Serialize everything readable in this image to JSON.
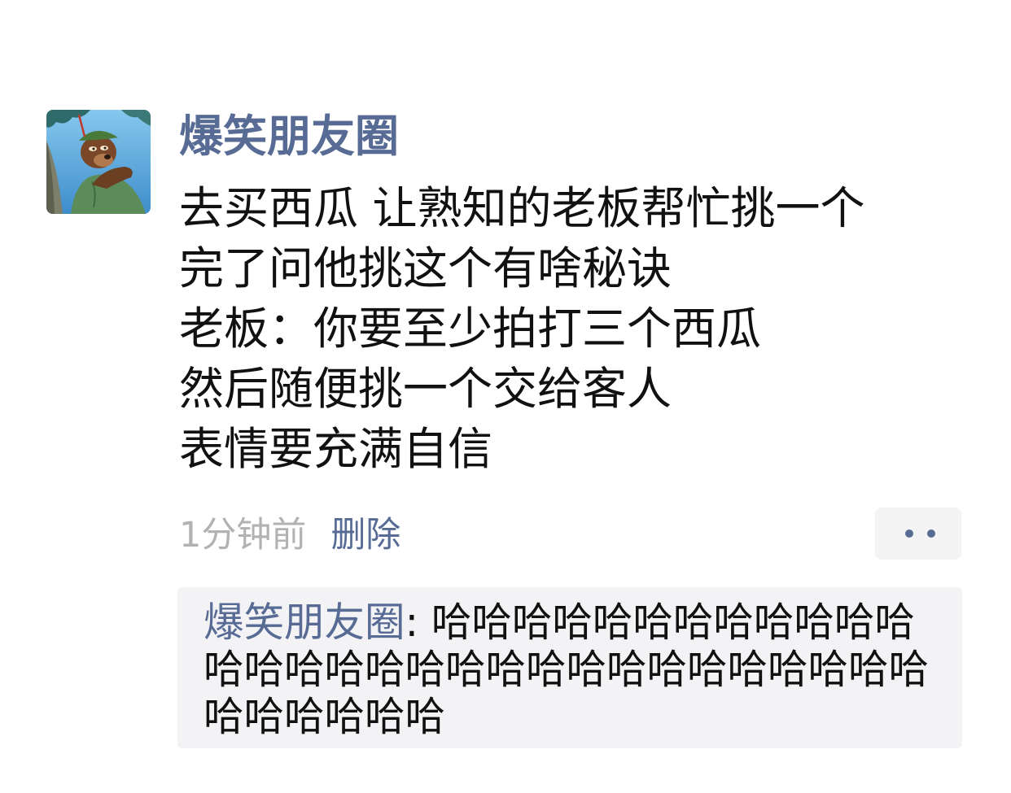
{
  "post": {
    "author": "爆笑朋友圈",
    "avatar_icon": "cartoon-bear-avatar",
    "lines": [
      "去买西瓜 让熟知的老板帮忙挑一个",
      "完了问他挑这个有啥秘诀",
      "老板：你要至少拍打三个西瓜",
      "然后随便挑一个交给客人",
      "表情要充满自信"
    ],
    "time": "1分钟前",
    "delete_label": "删除"
  },
  "more_button": {
    "icon": "more-dots-icon"
  },
  "comment": {
    "author": "爆笑朋友圈",
    "separator": ": ",
    "text": "哈哈哈哈哈哈哈哈哈哈哈哈哈哈哈哈哈哈哈哈哈哈哈哈哈哈哈哈哈哈哈哈哈哈哈哈"
  },
  "colors": {
    "link": "#576b95",
    "text": "#111111",
    "muted": "#b2b2b2",
    "comment_background": "#f3f3f5",
    "more_button_background": "#f4f4f4"
  }
}
